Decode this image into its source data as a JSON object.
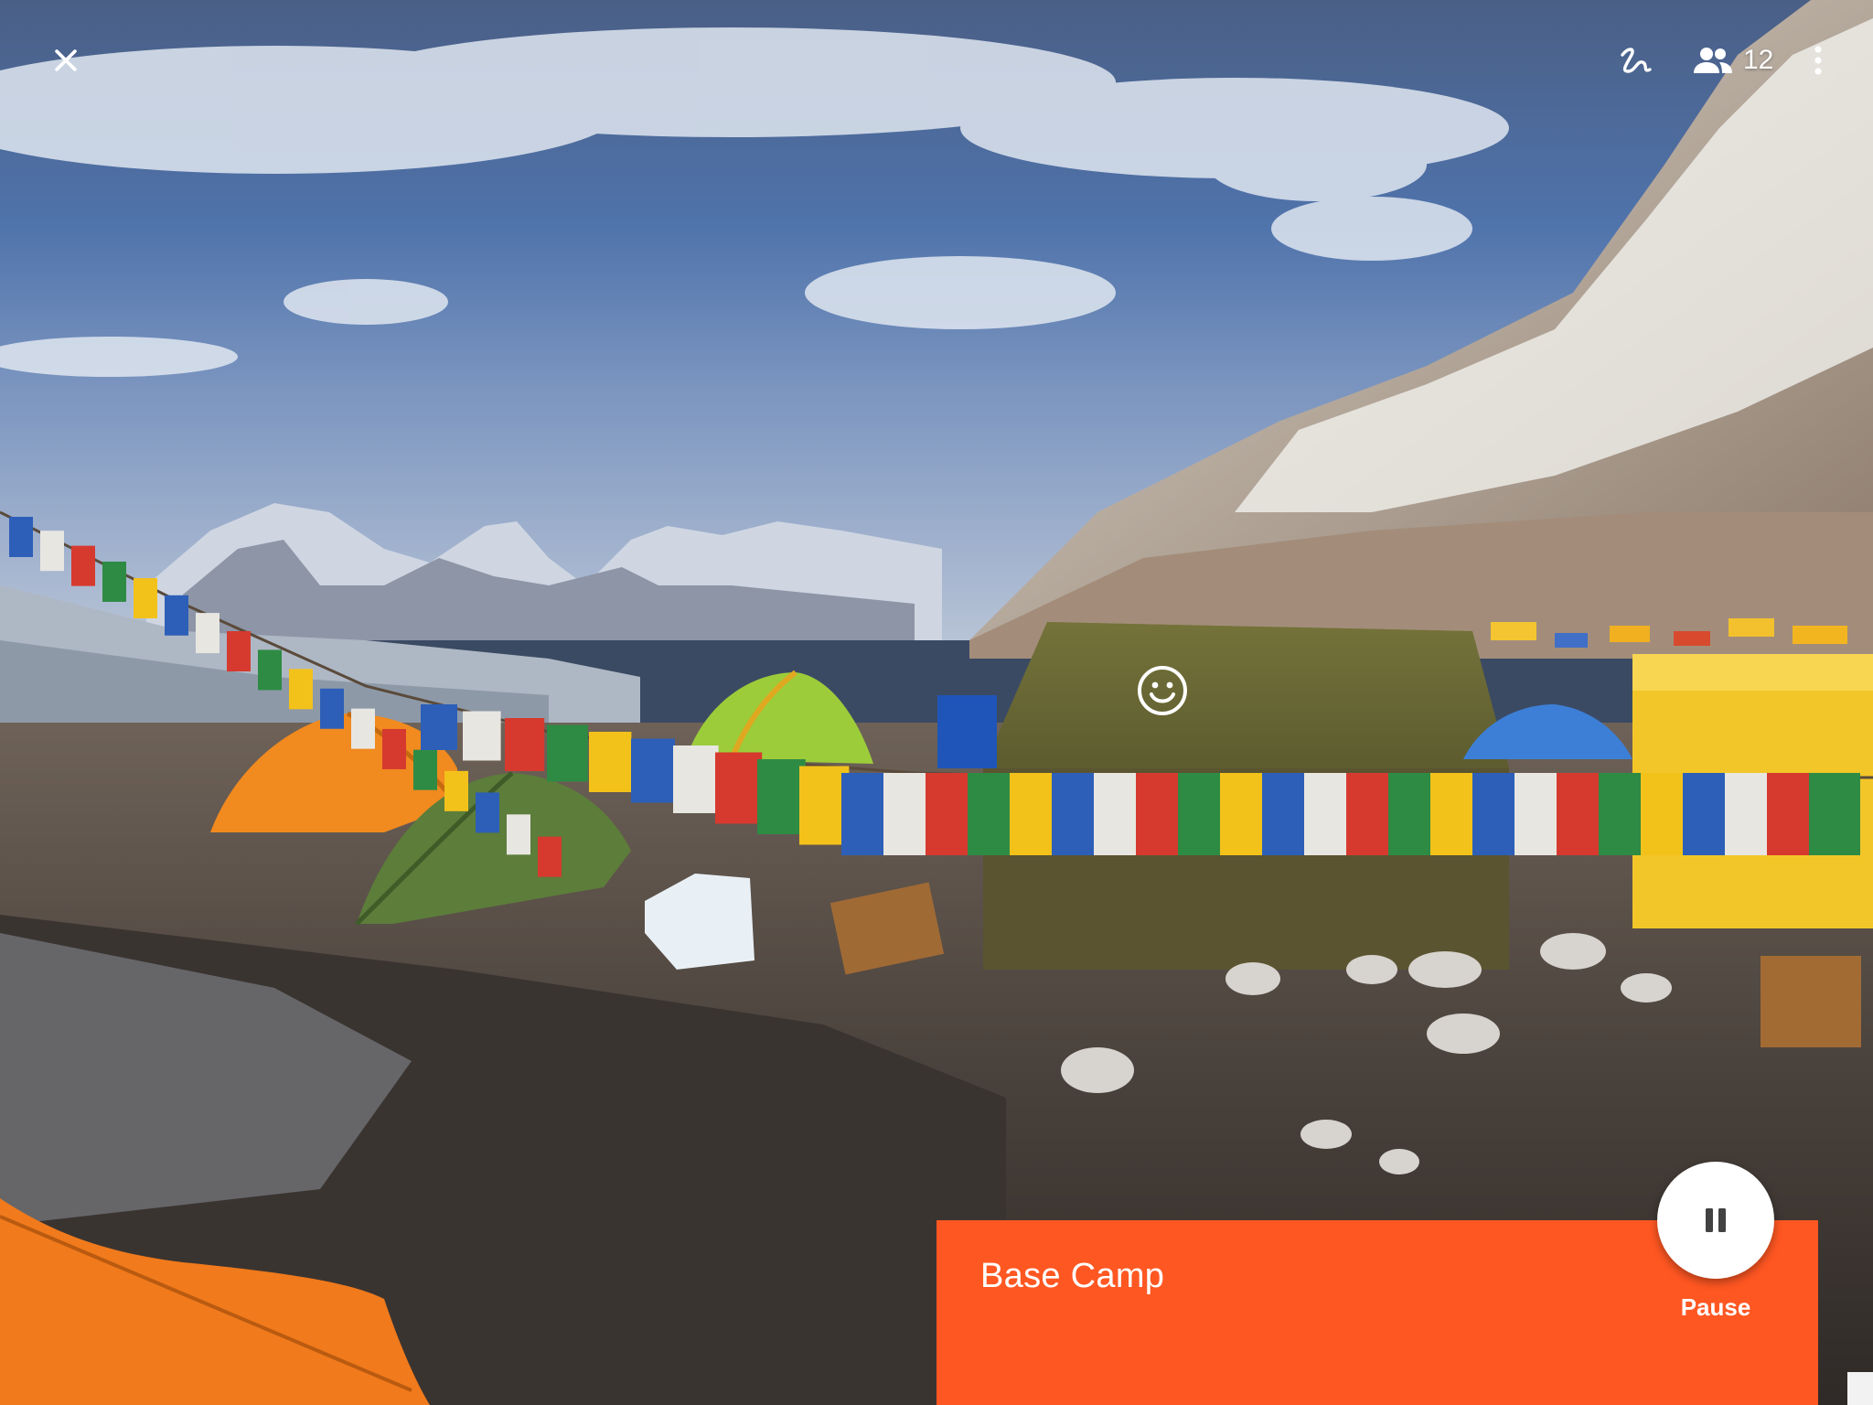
{
  "toolbar": {
    "close_icon": "close-icon",
    "tag_icon": "squiggle-tag-icon",
    "viewers_icon": "people-icon",
    "viewer_count": "12",
    "more_icon": "more-vertical-icon"
  },
  "scene": {
    "marker_icon": "smiley-face-icon"
  },
  "card": {
    "title": "Base Camp",
    "pause_label": "Pause",
    "pause_icon": "pause-icon"
  },
  "colors": {
    "card_background": "#ff5722",
    "icon_color": "#ffffff",
    "pause_button_background": "#ffffff",
    "pause_icon_color": "#424242"
  }
}
